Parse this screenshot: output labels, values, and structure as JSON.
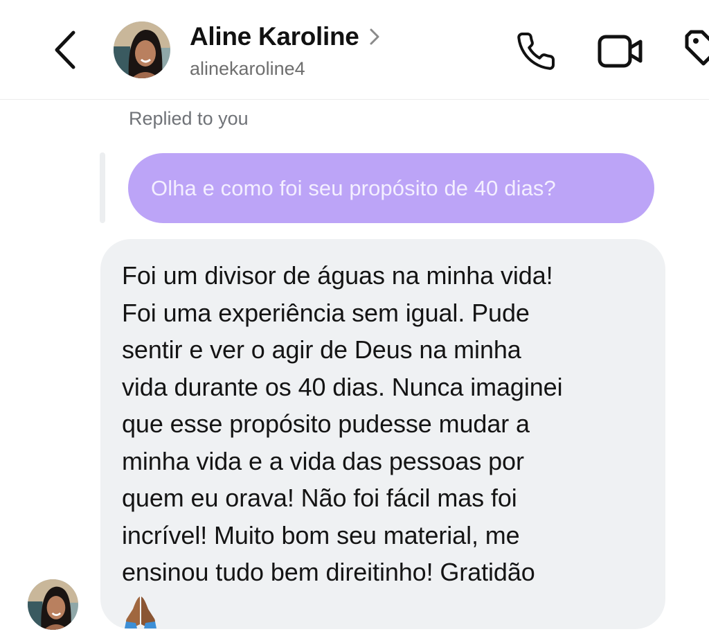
{
  "header": {
    "contact_name": "Aline Karoline",
    "contact_handle": "alinekaroline4"
  },
  "thread": {
    "replied_label": "Replied to you",
    "quoted_message": "Olha e como foi seu propósito de 40 dias?",
    "reply_message": "Foi um divisor de águas na minha vida!\nFoi uma experiência sem igual. Pude\nsentir e ver o agir de Deus na minha\nvida durante os 40 dias. Nunca imaginei\nque esse propósito pudesse mudar a\nminha vida e a vida das pessoas por\nquem eu orava! Não foi fácil mas foi\nincrível! Muito bom seu material, me\nensinou tudo bem direitinho! Gratidão",
    "reply_emoji": "praying-hands-icon"
  },
  "colors": {
    "quoted_bubble": "#bca4f7",
    "received_bubble": "#eff1f3",
    "reply_bar": "#eceef0"
  }
}
